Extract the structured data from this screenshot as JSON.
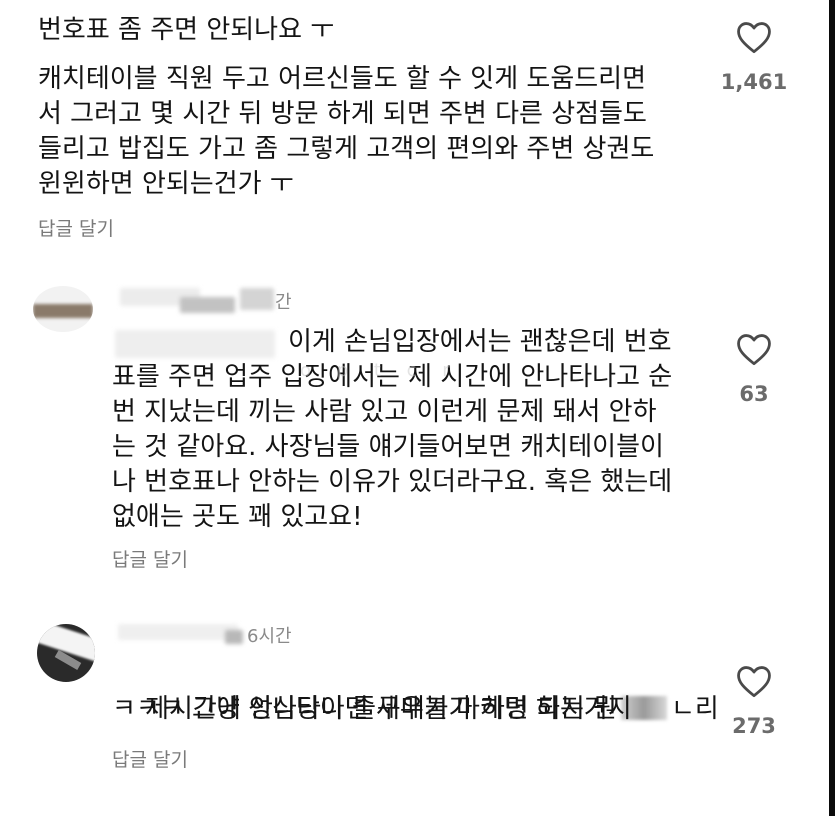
{
  "comments": [
    {
      "text_line1": "번호표 좀 주면 안되나요 ㅜ",
      "text_rest": "캐치테이블 직원 두고 어르신들도 할 수 잇게 도움드리면\n서 그러고 몇 시간 뒤 방문 하게 되면 주변 다른 상점들도\n들리고 밥집도 가고 좀 그렇게 고객의 편의와 주변 상권도\n윈윈하면 안되는건가 ㅜ",
      "likes": "1,461",
      "reply_label": "답글 달기"
    },
    {
      "time": "간",
      "text": "이게 손님입장에서는 괜찮은데 번호\n표를 주면 업주 입장에서는 제 시간에 안나타나고 순\n번 지났는데 끼는 사람 있고 이런게 문제 돼서 안하\n는 것 같아요. 사장님들 얘기들어보면 캐치테이블이\n나 번호표나 안하는 이유가 있더라구요. 혹은 했는데\n없애는 곳도 꽤 있고요!",
      "likes": "63",
      "reply_label": "답글 달기"
    },
    {
      "time": "6시간",
      "text_part1": "제시간에 안나타나면 구매불가 하면 되지 뭔",
      "text_part1_tail": "ㄴ리",
      "text_line2": "ㅋㅋㅋ 그냥 성심당이 줄세우기 마케팅 하는거지",
      "likes": "273",
      "reply_label": "답글 달기"
    }
  ],
  "colors": {
    "text": "#141414",
    "secondary": "#7a7a7a",
    "background": "#ffffff"
  }
}
